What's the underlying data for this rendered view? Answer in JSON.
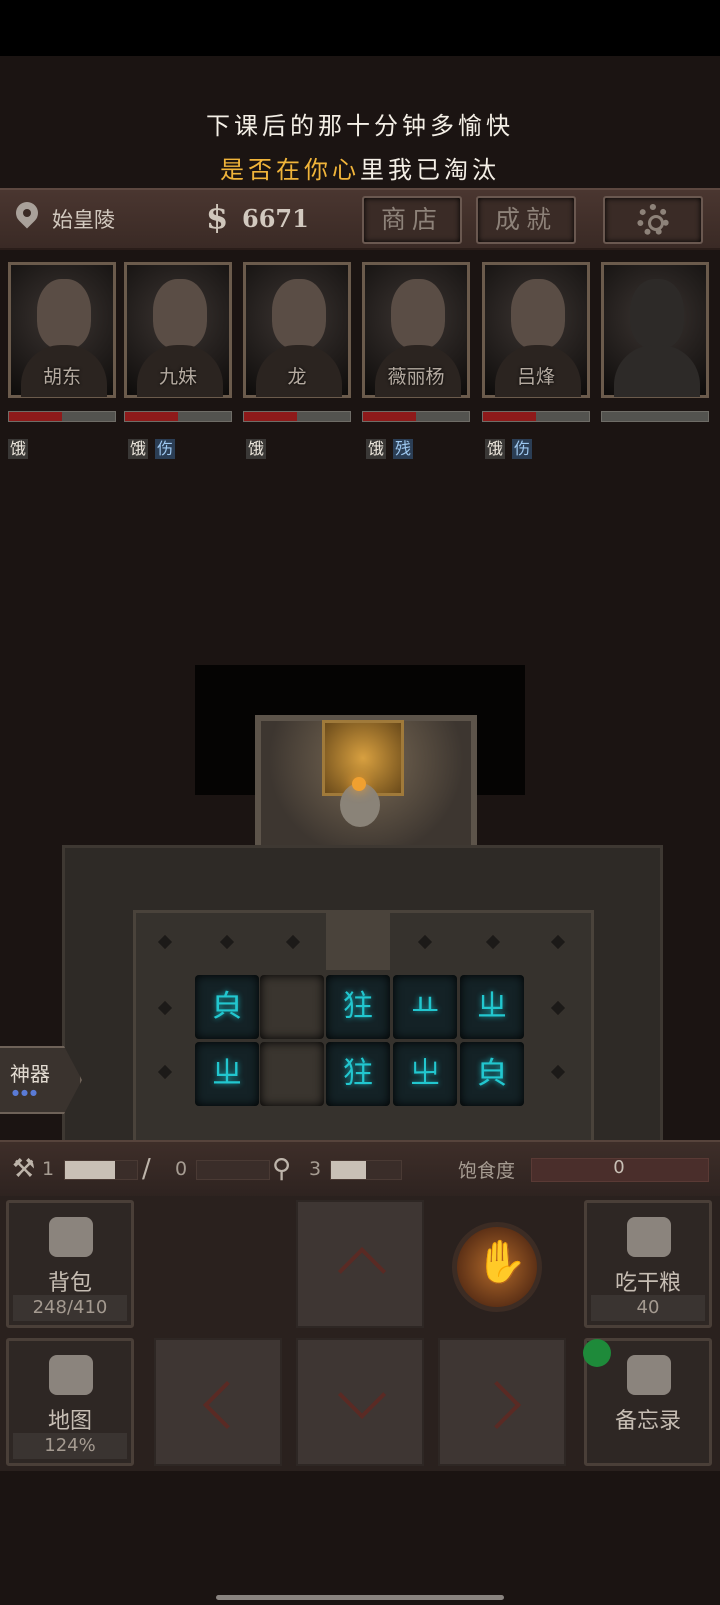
{
  "lyrics": {
    "line1": "下课后的那十分钟多愉快",
    "line2_highlight": "是否在你心",
    "line2_rest": "里我已淘汰"
  },
  "status": {
    "location": "始皇陵",
    "currency_symbol": "$",
    "money": "6671",
    "shop_label": "商店",
    "achievements_label": "成就"
  },
  "party": [
    {
      "name": "胡东",
      "health": 0.5,
      "tags": [
        "饿"
      ]
    },
    {
      "name": "九妹",
      "health": 0.5,
      "tags": [
        "饿",
        "伤"
      ]
    },
    {
      "name": "龙",
      "health": 0.5,
      "tags": [
        "饿"
      ]
    },
    {
      "name": "薇丽杨",
      "health": 0.5,
      "tags": [
        "饿",
        "残"
      ]
    },
    {
      "name": "吕烽",
      "health": 0.5,
      "tags": [
        "饿",
        "伤"
      ]
    },
    {
      "name": "",
      "health": 0,
      "tags": []
    }
  ],
  "puzzle": {
    "tiles_row1": [
      "㒵",
      "㹥",
      "ㅛ",
      "ㄓ"
    ],
    "tiles_row2": [
      "ㄓ",
      "㹥",
      "㞢",
      "㒵"
    ]
  },
  "artifact": {
    "label": "神器",
    "dots": "●●●"
  },
  "resources": {
    "torch_count": "1",
    "rope_count": "0",
    "shovel_count": "3",
    "satiety_label": "饱食度",
    "satiety_value": "0"
  },
  "actions": {
    "backpack_label": "背包",
    "backpack_count": "248/410",
    "eat_label": "吃干粮",
    "eat_count": "40",
    "map_label": "地图",
    "map_percent": "124%",
    "memo_label": "备忘录"
  }
}
